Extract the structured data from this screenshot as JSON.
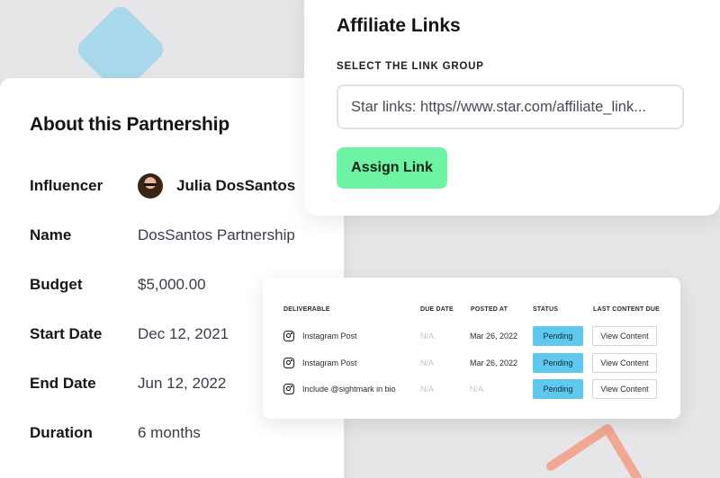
{
  "partnership": {
    "title": "About this Partnership",
    "rows": [
      {
        "label": "Influencer",
        "value": "Julia DosSantos"
      },
      {
        "label": "Name",
        "value": "DosSantos Partnership"
      },
      {
        "label": "Budget",
        "value": "$5,000.00"
      },
      {
        "label": "Start Date",
        "value": "Dec 12, 2021"
      },
      {
        "label": "End Date",
        "value": "Jun 12, 2022"
      },
      {
        "label": "Duration",
        "value": "6 months"
      }
    ]
  },
  "affiliate": {
    "title": "Affiliate Links",
    "select_label": "SELECT THE LINK GROUP",
    "link_value": "Star links: https//www.star.com/affiliate_link...",
    "assign_label": "Assign Link"
  },
  "deliverables": {
    "headers": [
      "DELIVERABLE",
      "DUE DATE",
      "POSTED AT",
      "STATUS",
      "LAST CONTENT DUE"
    ],
    "rows": [
      {
        "name": "Instagram Post",
        "due": "N/A",
        "posted": "Mar 26, 2022",
        "status": "Pending",
        "action": "View Content"
      },
      {
        "name": "Instagram Post",
        "due": "N/A",
        "posted": "Mar 26, 2022",
        "status": "Pending",
        "action": "View Content"
      },
      {
        "name": "Include @sightmark in bio",
        "due": "N/A",
        "posted": "N/A",
        "status": "Pending",
        "action": "View Content"
      }
    ]
  },
  "colors": {
    "assign_button": "#6ef2a3",
    "pending_badge": "#5fc8ef",
    "diamond": "#a9d8ea",
    "stripes": "#b9b4f5",
    "triangle": "#f1a792"
  },
  "icons": {
    "deliverable": "instagram-icon"
  }
}
